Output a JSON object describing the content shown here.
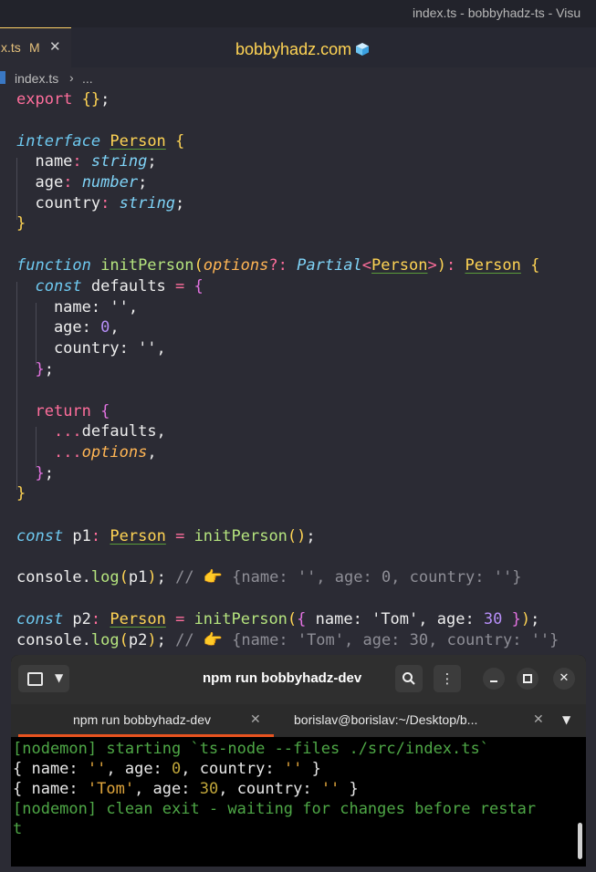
{
  "window": {
    "title": "index.ts - bobbyhadz-ts - Visu"
  },
  "tab": {
    "name": "x.ts",
    "modified_marker": "M",
    "close_glyph": "✕"
  },
  "brand": {
    "text": "bobbyhadz.com",
    "icon": "ice-cube-icon"
  },
  "breadcrumb": {
    "file": "index.ts",
    "separator": "›",
    "rest": "..."
  },
  "code": {
    "l1": [
      "export",
      " ",
      "{}",
      ";"
    ],
    "l2": [
      "interface",
      " ",
      "Person",
      " ",
      "{"
    ],
    "l3": [
      "  name",
      ":",
      " ",
      "string",
      ";"
    ],
    "l4": [
      "  age",
      ":",
      " ",
      "number",
      ";"
    ],
    "l5": [
      "  country",
      ":",
      " ",
      "string",
      ";"
    ],
    "l6": [
      "}"
    ],
    "l7": [
      "function",
      " initPerson",
      "(",
      "options",
      "?:",
      " ",
      "Partial",
      "<",
      "Person",
      ">",
      ")",
      ":",
      " ",
      "Person",
      " ",
      "{"
    ],
    "l8": [
      "  ",
      "const",
      " defaults ",
      "=",
      " ",
      "{"
    ],
    "l9": [
      "    name: ",
      "''",
      ","
    ],
    "l10": [
      "    age: ",
      "0",
      ","
    ],
    "l11": [
      "    country: ",
      "''",
      ","
    ],
    "l12": [
      "  ",
      "}",
      ";"
    ],
    "l13": [
      "  ",
      "return",
      " ",
      "{"
    ],
    "l14": [
      "    ",
      "...",
      "defaults,"
    ],
    "l15": [
      "    ",
      "...",
      "options",
      ","
    ],
    "l16": [
      "  ",
      "}",
      ";"
    ],
    "l17": [
      "}"
    ],
    "l18": [
      "const",
      " p1",
      ":",
      " ",
      "Person",
      " ",
      "=",
      " initPerson",
      "()",
      ";"
    ],
    "l19": [
      "console.",
      "log",
      "(",
      "p1",
      ")",
      ";",
      " // 👉 {name: '', age: 0, country: ''}"
    ],
    "l20": [
      "const",
      " p2",
      ":",
      " ",
      "Person",
      " ",
      "=",
      " initPerson",
      "(",
      "{",
      " name: ",
      "'Tom'",
      ", age: ",
      "30",
      " ",
      "}",
      ")",
      ";"
    ],
    "l21": [
      "console.",
      "log",
      "(",
      "p2",
      ")",
      ";",
      " // 👉 {name: 'Tom', age: 30, country: ''}"
    ]
  },
  "terminal": {
    "title": "npm run bobbyhadz-dev",
    "tabs": [
      {
        "label": "npm run bobbyhadz-dev",
        "close": "✕"
      },
      {
        "label": "borislav@borislav:~/Desktop/b...",
        "close": "✕"
      }
    ],
    "buttons": {
      "search": "⌕",
      "menu": "⋮",
      "minimize": "—",
      "maximize": "□",
      "close": "✕"
    },
    "output": {
      "line1": "[nodemon] starting `ts-node --files ./src/index.ts`",
      "line2": [
        "{ name: ",
        "''",
        ", age: ",
        "0",
        ", country: ",
        "''",
        " }"
      ],
      "line3": [
        "{ name: ",
        "'Tom'",
        ", age: ",
        "30",
        ", country: ",
        "''",
        " }"
      ],
      "line4": "[nodemon] clean exit - waiting for changes before restar",
      "line5": "t"
    }
  },
  "colors": {
    "accent": "#e95420",
    "brand": "#ffd454",
    "keyword": "#ff6e9c"
  }
}
